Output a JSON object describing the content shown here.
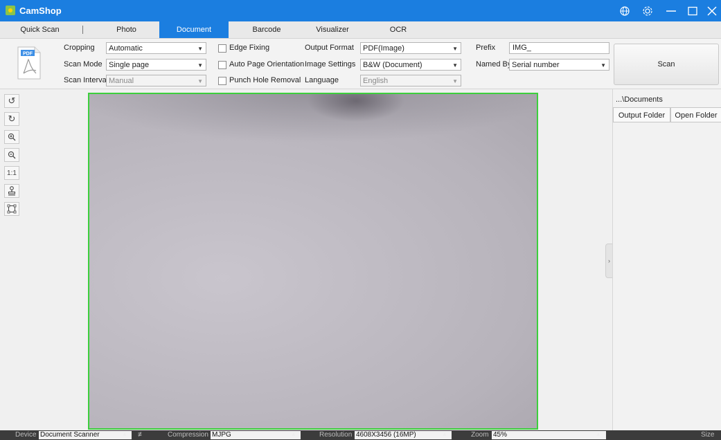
{
  "app": {
    "title": "CamShop"
  },
  "window_controls": [
    "globe-icon",
    "settings-icon",
    "minimize-icon",
    "maximize-icon",
    "close-icon"
  ],
  "tabs": [
    {
      "label": "Quick Scan"
    },
    {
      "label": "Photo"
    },
    {
      "label": "Document",
      "active": true
    },
    {
      "label": "Barcode"
    },
    {
      "label": "Visualizer"
    },
    {
      "label": "OCR"
    }
  ],
  "toolbar": {
    "pdf_badge": "PDF",
    "cropping": {
      "label": "Cropping",
      "value": "Automatic"
    },
    "scan_mode": {
      "label": "Scan Mode",
      "value": "Single page"
    },
    "scan_interval": {
      "label": "Scan Interval",
      "value": "Manual"
    },
    "edge_fixing": {
      "label": "Edge Fixing",
      "checked": false
    },
    "auto_orientation": {
      "label": "Auto Page Orientation",
      "checked": false
    },
    "punch_hole": {
      "label": "Punch Hole Removal",
      "checked": false
    },
    "output_format": {
      "label": "Output Format",
      "value": "PDF(Image)"
    },
    "image_settings": {
      "label": "Image Settings",
      "value": "B&W (Document)"
    },
    "language": {
      "label": "Language",
      "value": "English"
    },
    "prefix": {
      "label": "Prefix",
      "value": "IMG_"
    },
    "named_by": {
      "label": "Named By",
      "value": "Serial number"
    },
    "scan_button": "Scan"
  },
  "left_tools": [
    {
      "name": "rotate-left-icon",
      "glyph": "↺"
    },
    {
      "name": "rotate-right-icon",
      "glyph": "↻"
    },
    {
      "name": "zoom-in-icon",
      "glyph": "⊕"
    },
    {
      "name": "zoom-out-icon",
      "glyph": "⊖"
    },
    {
      "name": "actual-size-icon",
      "glyph": "1:1"
    },
    {
      "name": "stamp-icon",
      "glyph": "⚲"
    },
    {
      "name": "crop-frame-icon",
      "glyph": "⌑"
    }
  ],
  "right_panel": {
    "path": "...\\Documents",
    "output_folder": "Output Folder",
    "open_folder": "Open Folder"
  },
  "status": {
    "device": {
      "label": "Device",
      "value": "Document Scanner"
    },
    "compression": {
      "label": "Compression",
      "value": "MJPG"
    },
    "resolution": {
      "label": "Resolution",
      "value": "4608X3456 (16MP)"
    },
    "zoom": {
      "label": "Zoom",
      "value": "45%"
    },
    "size": {
      "label": "Size"
    }
  },
  "colors": {
    "accent": "#1b7ee0",
    "crop_frame": "#3ccf3c",
    "statusbar": "#3c3c3c"
  }
}
